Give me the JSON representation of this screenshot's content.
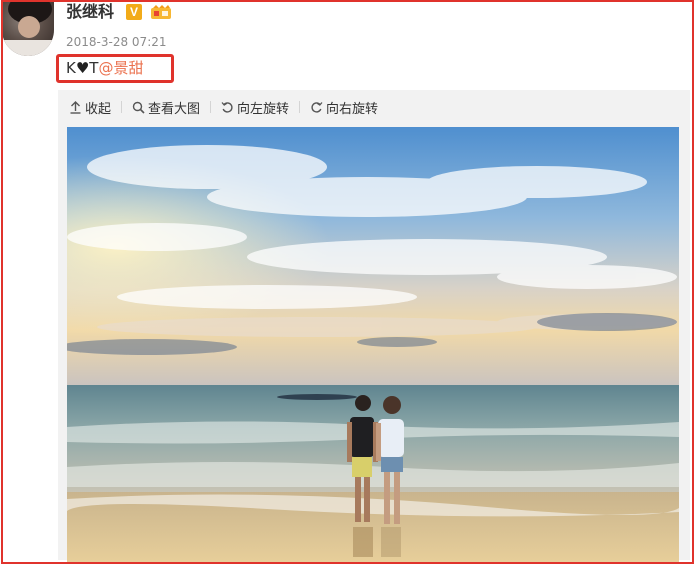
{
  "post": {
    "username": "张继科",
    "verified_badge": "V",
    "timestamp": "2018-3-28 07:21",
    "text_prefix": "K",
    "text_heart": "♥",
    "text_suffix": "T",
    "mention": "@景甜"
  },
  "toolbar": {
    "collapse_label": "收起",
    "view_large_label": "查看大图",
    "rotate_left_label": "向左旋转",
    "rotate_right_label": "向右旋转"
  },
  "colors": {
    "highlight_border": "#e0332c",
    "mention_link": "#eb7350",
    "badge_orange": "#f2ab19",
    "panel_bg": "#f2f2f2"
  },
  "icons": {
    "collapse": "collapse-up-arrow-icon",
    "zoom": "magnifier-icon",
    "rotate_left": "rotate-left-icon",
    "rotate_right": "rotate-right-icon",
    "verified": "verified-v-icon",
    "vip": "vip-member-icon"
  }
}
